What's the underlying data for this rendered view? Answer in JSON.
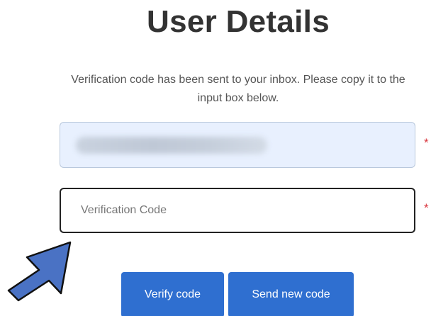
{
  "page": {
    "title": "User Details",
    "message": "Verification code has been sent to your inbox. Please copy it to the input box below."
  },
  "form": {
    "email_value": "",
    "verification_placeholder": "Verification Code",
    "verification_value": "",
    "required_marker": "*"
  },
  "buttons": {
    "verify_label": "Verify code",
    "send_new_label": "Send new code"
  },
  "colors": {
    "button_bg": "#2f6fd0",
    "email_field_bg": "#e8f0fe",
    "arrow_fill": "#4a72c4",
    "required": "#d9363e"
  },
  "icons": {
    "annotation": "arrow-up-right-icon"
  }
}
